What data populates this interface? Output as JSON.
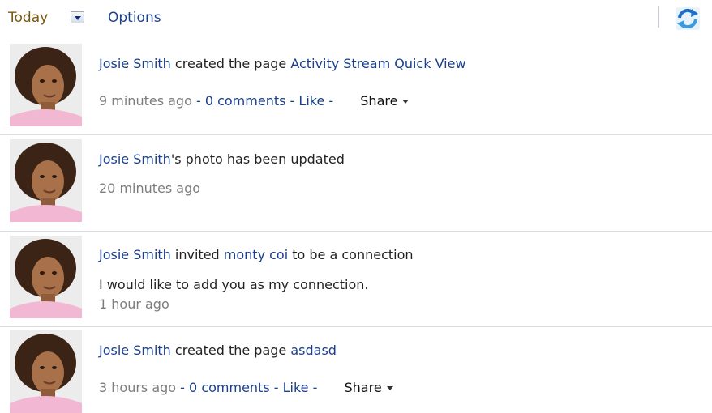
{
  "toolbar": {
    "filter_label": "Today",
    "options_label": "Options",
    "refresh_icon": "refresh-icon"
  },
  "entries": [
    {
      "actor": "Josie Smith",
      "action": " created the page ",
      "target": "Activity Stream Quick View",
      "time": "9 minutes ago",
      "sep1": " - ",
      "comments": "0 comments",
      "sep2": " - ",
      "like": "Like",
      "sep3": " - ",
      "share": "Share"
    },
    {
      "actor": "Josie Smith",
      "action": "'s photo has been updated",
      "time": "20 minutes ago"
    },
    {
      "actor": "Josie Smith",
      "action": " invited ",
      "target": "monty coi",
      "action2": " to be a connection",
      "message": "I would like to add you as my connection.",
      "time": "1 hour ago"
    },
    {
      "actor": "Josie Smith",
      "action": " created the page ",
      "target": "asdasd",
      "time": "3 hours ago",
      "sep1": " - ",
      "comments": "0 comments",
      "sep2": " - ",
      "like": "Like",
      "sep3": " - ",
      "share": "Share"
    }
  ]
}
